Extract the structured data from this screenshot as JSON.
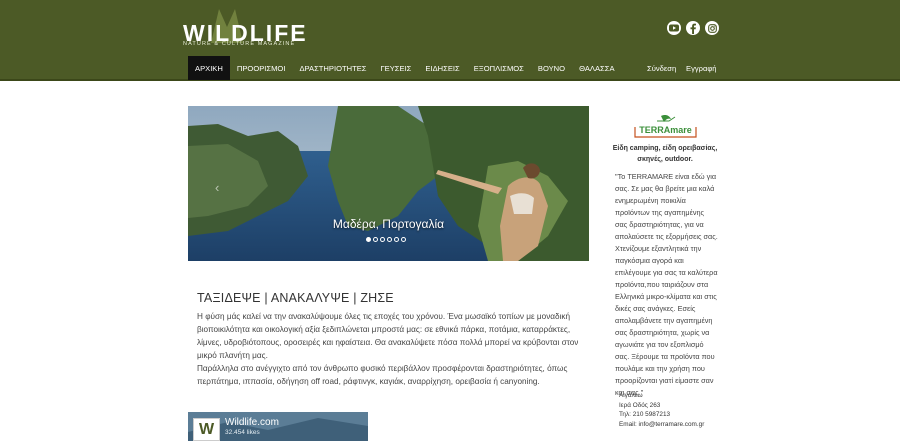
{
  "brand": {
    "name": "WILDLIFE",
    "tagline": "NATURE & CULTURE MAGAZINE",
    "color_header": "#4c5a26",
    "color_nav_active": "#111111"
  },
  "social": [
    {
      "name": "youtube",
      "icon": "youtube-icon"
    },
    {
      "name": "facebook",
      "icon": "facebook-icon"
    },
    {
      "name": "instagram",
      "icon": "instagram-icon"
    }
  ],
  "nav": {
    "items": [
      {
        "label": "ΑΡΧΙΚΗ",
        "active": true
      },
      {
        "label": "ΠΡΟΟΡΙΣΜΟΙ"
      },
      {
        "label": "ΔΡΑΣΤΗΡΙΟΤΗΤΕΣ"
      },
      {
        "label": "ΓΕΥΣΕΙΣ"
      },
      {
        "label": "ΕΙΔΗΣΕΙΣ"
      },
      {
        "label": "ΕΞΟΠΛΙΣΜΟΣ"
      },
      {
        "label": "ΒΟΥΝΟ"
      },
      {
        "label": "ΘΑΛΑΣΣΑ"
      }
    ],
    "login": "Σύνδεση",
    "register": "Εγγραφή"
  },
  "slider": {
    "caption": "Μαδέρα, Πορτογαλία",
    "slide_count": 6,
    "active_slide": 1
  },
  "main": {
    "title": "ΤΑΞΙΔΕΨΕ | ΑΝΑΚΑΛΥΨΕ | ΖΗΣΕ",
    "paragraph1": "Η φύση μάς καλεί να την ανακαλύψουμε όλες τις εποχές του χρόνου. Ένα μωσαϊκό τοπίων με μοναδική βιοποικιλότητα και οικολογική αξία ξεδιπλώνεται μπροστά μας: σε εθνικά πάρκα, ποτάμια, καταρράκτες, λίμνες, υδροβιότοπους, οροσειρές και ηφαίστεια. Θα ανακαλύψετε πόσα πολλά μπορεί να κρύβονται στον μικρό πλανήτη μας.",
    "paragraph2": "Παράλληλα στο ανέγγιχτο από τον άνθρωπο φυσικό περιβάλλον προσφέρονται δραστηριότητες, όπως περπάτημα, ιππασία, οδήγηση off road, ράφτινγκ, καγιάκ, αναρρίχηση, ορειβασία ή canyoning."
  },
  "facebook_widget": {
    "name": "Wildlife.com",
    "likes": "32.454 likes",
    "logo_letter": "W"
  },
  "sidebar": {
    "logo_text": "TERRAmare",
    "subtitle": "Είδη camping, είδη ορειβασίας, σκηνές, outdoor.",
    "text": "\"Το TERRAMARE είναι εδώ για σας. Σε μας θα βρείτε μια καλά ενημερωμένη ποικιλία προϊόντων της αγαπημένης σας δραστηριότητας, για να απολαύσετε τις εξορμήσεις σας. Χτενίζουμε εξαντλητικά την παγκόσμια αγορά και επιλέγουμε για σας τα καλύτερα προϊόντα,που ταιριάζουν στα Ελληνικά μικρο-κλίματα και στις δικές σας ανάγκες. Εσείς απολαμβάνετε την αγαπημένη σας δραστηριότητα, χωρίς να αγωνιάτε για τον εξοπλισμό σας. Ξέρουμε τα προϊόντα που πουλάμε και την χρήση που προορίζονται γιατί είμαστε σαν και σας.\"",
    "contact": {
      "city": "Αιγάλεω",
      "address": "Ιερά Οδός 263",
      "phone": "Τηλ: 210 5987213",
      "email": "Email: info@terramare.com.gr"
    }
  }
}
